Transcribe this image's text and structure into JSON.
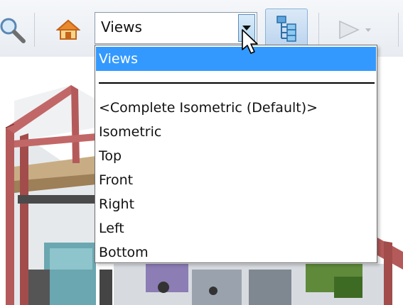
{
  "toolbar": {
    "icons": [
      "search-icon",
      "home-icon",
      "view-tree-icon",
      "play-icon"
    ],
    "view_select": {
      "value": "Views",
      "options": [
        "Views",
        "",
        "<Complete Isometric (Default)>",
        "Isometric",
        "Top",
        "Front",
        "Right",
        "Left",
        "Bottom"
      ]
    }
  },
  "colors": {
    "highlight": "#3399ff",
    "frame": "#b55a5a",
    "toolbar": "#eaeef3"
  }
}
